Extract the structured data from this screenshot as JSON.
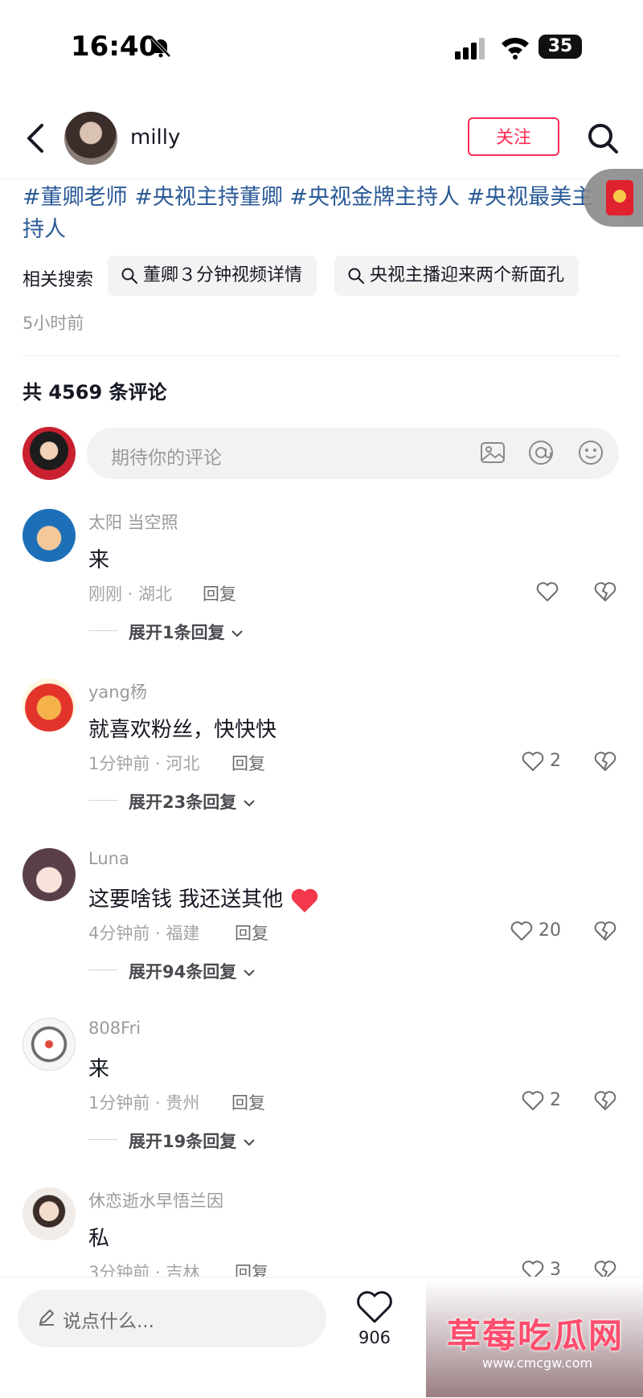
{
  "status_bar": {
    "time": "16:40",
    "battery": "35"
  },
  "header": {
    "username": "milly",
    "follow_label": "关注"
  },
  "post": {
    "hashtags": "#董卿老师 #央视主持董卿 #央视金牌主持人 #央视最美主持人",
    "related_label": "相关搜索",
    "related_searches": [
      "董卿３分钟视频详情",
      "央视主播迎来两个新面孔"
    ],
    "posted_time": "5小时前"
  },
  "comments_header": {
    "count_text": "共 4569 条评论"
  },
  "comment_input": {
    "placeholder": "期待你的评论"
  },
  "comments": [
    {
      "name": "太阳 当空照",
      "text": "来",
      "meta": "刚刚 · 湖北",
      "reply": "回复",
      "likes": "",
      "expand": "展开1条回复"
    },
    {
      "name": "yang杨",
      "text": "就喜欢粉丝，快快快",
      "meta": "1分钟前 · 河北",
      "reply": "回复",
      "likes": "2",
      "expand": "展开23条回复"
    },
    {
      "name": "Luna",
      "text": "这要啥钱 我还送其他",
      "meta": "4分钟前 · 福建",
      "reply": "回复",
      "likes": "20",
      "expand": "展开94条回复"
    },
    {
      "name": "808Fri",
      "text": "来",
      "meta": "1分钟前 · 贵州",
      "reply": "回复",
      "likes": "2",
      "expand": "展开19条回复"
    },
    {
      "name": "休恋逝水早悟兰因",
      "text": "私",
      "meta": "3分钟前 · 吉林",
      "reply": "回复",
      "likes": "3",
      "expand": ""
    }
  ],
  "bottom_bar": {
    "placeholder": "说点什么...",
    "like_count": "906"
  },
  "watermark": {
    "title": "草莓吃瓜网",
    "url": "www.cmcgw.com"
  },
  "colors": {
    "accent": "#fe2c55",
    "hashtag": "#2a5a97",
    "muted": "#9a9a9e"
  },
  "icons": [
    "bell-slash-icon",
    "signal-icon",
    "wifi-icon",
    "back-icon",
    "search-icon",
    "image-icon",
    "at-icon",
    "emoji-icon",
    "heart-icon",
    "broken-heart-icon",
    "chevron-down-icon",
    "pencil-icon",
    "red-envelope-icon"
  ]
}
